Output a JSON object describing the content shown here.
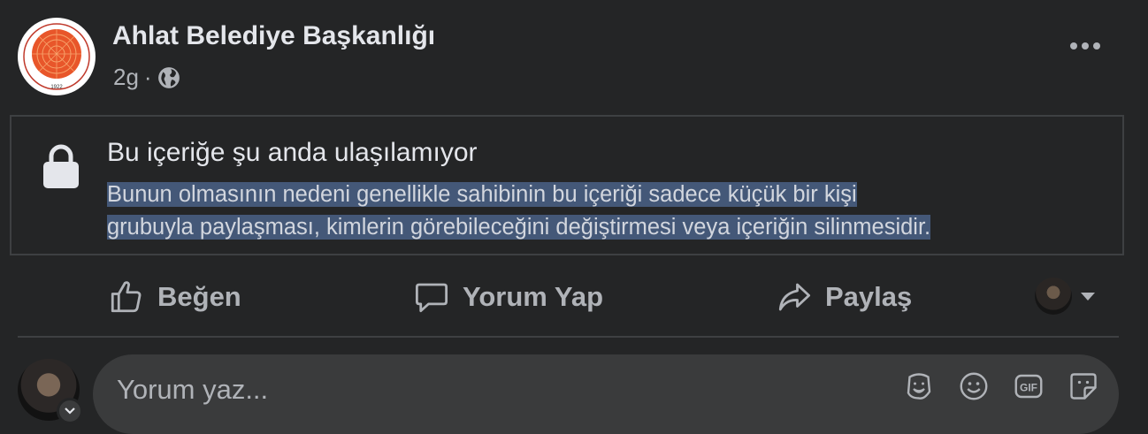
{
  "post": {
    "page_name": "Ahlat Belediye Başkanlığı",
    "time": "2g",
    "separator": "·",
    "logo_year": "1922",
    "icons": {
      "audience": "globe-icon",
      "menu": "more-options-icon"
    }
  },
  "unavailable": {
    "title": "Bu içeriğe şu anda ulaşılamıyor",
    "description_line1": "Bunun olmasının nedeni genellikle sahibinin bu içeriği sadece küçük bir kişi",
    "description_line2": "grubuyla paylaşması, kimlerin görebileceğini değiştirmesi veya içeriğin silinmesidir.",
    "icon": "lock-icon"
  },
  "actions": {
    "like": "Beğen",
    "comment": "Yorum Yap",
    "share": "Paylaş"
  },
  "comment_input": {
    "placeholder": "Yorum yaz...",
    "icons": [
      "avatar-sticker-icon",
      "emoji-icon",
      "gif-icon",
      "sticker-icon"
    ]
  },
  "colors": {
    "background": "#242526",
    "text_primary": "#e4e6eb",
    "text_secondary": "#b0b3b8",
    "selection_highlight": "#445878",
    "input_bg": "#3a3b3c"
  }
}
